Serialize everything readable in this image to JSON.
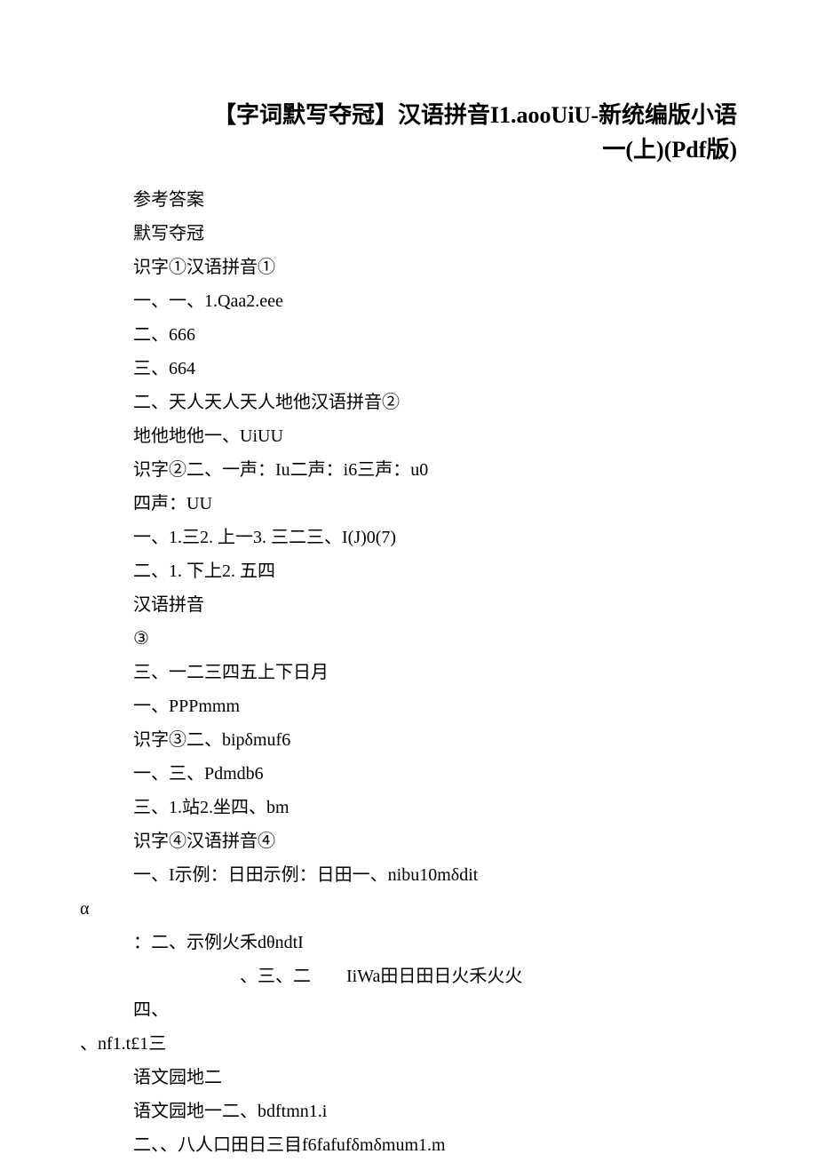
{
  "title": {
    "line1": "【字词默写夺冠】汉语拼音I1.aooUiU-新统编版小语",
    "line2": "一(上)(Pdf版)"
  },
  "lines": [
    {
      "cls": "indent1",
      "text": "参考答案"
    },
    {
      "cls": "indent1",
      "text": "默写夺冠"
    },
    {
      "cls": "indent1",
      "text": "识字①汉语拼音①"
    },
    {
      "cls": "indent1",
      "text": "一、一、1.Qaa2.eee"
    },
    {
      "cls": "indent1",
      "text": "二、666"
    },
    {
      "cls": "indent1",
      "text": "三、664"
    },
    {
      "cls": "indent1",
      "text": "二、天人天人天人地他汉语拼音②"
    },
    {
      "cls": "indent1",
      "text": "地他地他一、UiUU"
    },
    {
      "cls": "indent1",
      "text": "识字②二、一声：Iu二声：i6三声：u0"
    },
    {
      "cls": "indent1",
      "text": "四声：UU"
    },
    {
      "cls": "indent1",
      "text": "一、1.三2. 上一3. 三二三、I(J)0(7)"
    },
    {
      "cls": "indent1",
      "text": "二、1. 下上2. 五四"
    },
    {
      "cls": "indent1",
      "text": "汉语拼音"
    },
    {
      "cls": "indent1",
      "text": "③"
    },
    {
      "cls": "indent1",
      "text": "三、一二三四五上下日月"
    },
    {
      "cls": "indent1",
      "text": "一、PPPmmm"
    },
    {
      "cls": "indent1",
      "text": "识字③二、bipδmuf6"
    },
    {
      "cls": "indent1",
      "text": "一、三、Pdmdb6"
    },
    {
      "cls": "indent1",
      "text": "三、1.站2.坐四、bm"
    },
    {
      "cls": "indent1",
      "text": "识字④汉语拼音④"
    },
    {
      "cls": "indent1",
      "text": "一、I示例：日田示例：日田一、nibu10mδdit"
    },
    {
      "cls": "alpha-line",
      "text": "α"
    },
    {
      "cls": "indent1",
      "text": "：二、示例火禾dθndtI"
    },
    {
      "cls": "spaced-line",
      "text": "、三、二        IiWa田日田日火禾火火"
    },
    {
      "cls": "indent1",
      "text": "四、"
    },
    {
      "cls": "alpha-line",
      "text": "、nf1.t£1三"
    },
    {
      "cls": "indent1",
      "text": "语文园地二"
    },
    {
      "cls": "indent1",
      "text": "语文园地一二、bdftmn1.i"
    },
    {
      "cls": "indent1",
      "text": "二、、八人口田日三目f6fafufδmδmum1.m"
    }
  ]
}
